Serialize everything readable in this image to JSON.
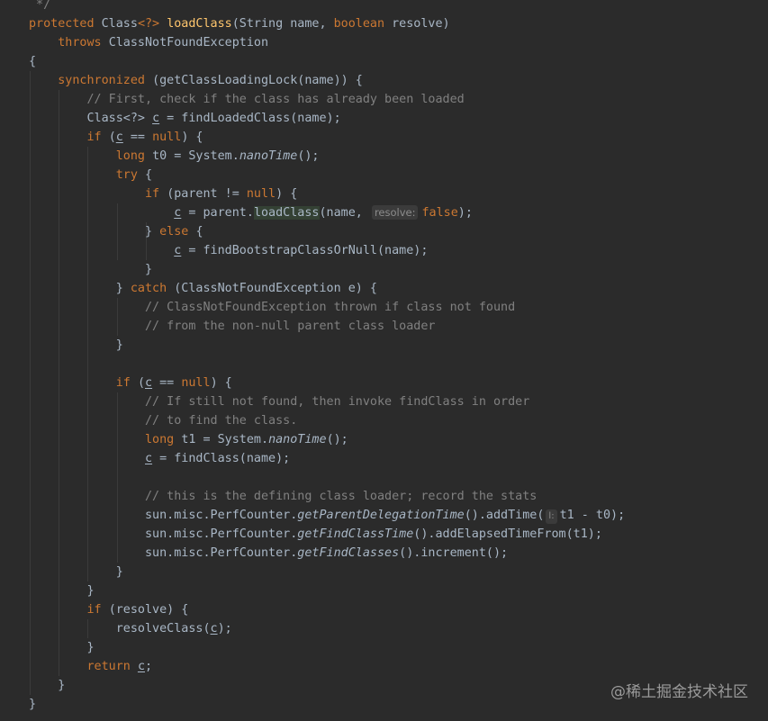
{
  "editor": {
    "lines": [
      [
        [
          "cm",
          " */"
        ]
      ],
      [
        [
          "kw",
          "protected "
        ],
        [
          "id",
          "Class"
        ],
        [
          "kw",
          "<?> "
        ],
        [
          "fn",
          "loadClass"
        ],
        [
          "id",
          "(String name, "
        ],
        [
          "kw",
          "boolean "
        ],
        [
          "id",
          "resolve)"
        ]
      ],
      [
        [
          "id",
          "    "
        ],
        [
          "kw",
          "throws "
        ],
        [
          "id",
          "ClassNotFoundException"
        ]
      ],
      [
        [
          "id",
          "{"
        ]
      ],
      [
        [
          "id",
          "    "
        ],
        [
          "kw",
          "synchronized "
        ],
        [
          "id",
          "(getClassLoadingLock(name)) {"
        ]
      ],
      [
        [
          "id",
          "        "
        ],
        [
          "cm",
          "// First, check if the class has already been loaded"
        ]
      ],
      [
        [
          "id",
          "        Class<?> "
        ],
        [
          "ul",
          "c"
        ],
        [
          "id",
          " = findLoadedClass(name);"
        ]
      ],
      [
        [
          "id",
          "        "
        ],
        [
          "kw",
          "if "
        ],
        [
          "id",
          "("
        ],
        [
          "ul",
          "c"
        ],
        [
          "id",
          " == "
        ],
        [
          "kw",
          "null"
        ],
        [
          "id",
          ") {"
        ]
      ],
      [
        [
          "id",
          "            "
        ],
        [
          "kw",
          "long "
        ],
        [
          "id",
          "t0 = System."
        ],
        [
          "it",
          "nanoTime"
        ],
        [
          "id",
          "();"
        ]
      ],
      [
        [
          "id",
          "            "
        ],
        [
          "kw",
          "try "
        ],
        [
          "id",
          "{"
        ]
      ],
      [
        [
          "id",
          "                "
        ],
        [
          "kw",
          "if "
        ],
        [
          "id",
          "(parent != "
        ],
        [
          "kw",
          "null"
        ],
        [
          "id",
          ") {"
        ]
      ],
      [
        [
          "id",
          "                    "
        ],
        [
          "ul",
          "c"
        ],
        [
          "id",
          " = parent."
        ],
        [
          "hl",
          "loadClass"
        ],
        [
          "id",
          "(name, "
        ],
        [
          "hint",
          "resolve:"
        ],
        [
          "kw",
          "false"
        ],
        [
          "id",
          ");"
        ]
      ],
      [
        [
          "id",
          "                } "
        ],
        [
          "kw",
          "else "
        ],
        [
          "id",
          "{"
        ]
      ],
      [
        [
          "id",
          "                    "
        ],
        [
          "ul",
          "c"
        ],
        [
          "id",
          " = findBootstrapClassOrNull(name);"
        ]
      ],
      [
        [
          "id",
          "                }"
        ]
      ],
      [
        [
          "id",
          "            } "
        ],
        [
          "kw",
          "catch "
        ],
        [
          "id",
          "(ClassNotFoundException e) {"
        ]
      ],
      [
        [
          "id",
          "                "
        ],
        [
          "cm",
          "// ClassNotFoundException thrown if class not found"
        ]
      ],
      [
        [
          "id",
          "                "
        ],
        [
          "cm",
          "// from the non-null parent class loader"
        ]
      ],
      [
        [
          "id",
          "            }"
        ]
      ],
      [
        [
          "id",
          ""
        ]
      ],
      [
        [
          "id",
          "            "
        ],
        [
          "kw",
          "if "
        ],
        [
          "id",
          "("
        ],
        [
          "ul",
          "c"
        ],
        [
          "id",
          " == "
        ],
        [
          "kw",
          "null"
        ],
        [
          "id",
          ") {"
        ]
      ],
      [
        [
          "id",
          "                "
        ],
        [
          "cm",
          "// If still not found, then invoke findClass in order"
        ]
      ],
      [
        [
          "id",
          "                "
        ],
        [
          "cm",
          "// to find the class."
        ]
      ],
      [
        [
          "id",
          "                "
        ],
        [
          "kw",
          "long "
        ],
        [
          "id",
          "t1 = System."
        ],
        [
          "it",
          "nanoTime"
        ],
        [
          "id",
          "();"
        ]
      ],
      [
        [
          "id",
          "                "
        ],
        [
          "ul",
          "c"
        ],
        [
          "id",
          " = findClass(name);"
        ]
      ],
      [
        [
          "id",
          ""
        ]
      ],
      [
        [
          "id",
          "                "
        ],
        [
          "cm",
          "// this is the defining class loader; record the stats"
        ]
      ],
      [
        [
          "id",
          "                sun.misc.PerfCounter."
        ],
        [
          "it",
          "getParentDelegationTime"
        ],
        [
          "id",
          "().addTime("
        ],
        [
          "icon",
          "l:"
        ],
        [
          "id",
          "t1 - t0);"
        ]
      ],
      [
        [
          "id",
          "                sun.misc.PerfCounter."
        ],
        [
          "it",
          "getFindClassTime"
        ],
        [
          "id",
          "().addElapsedTimeFrom(t1);"
        ]
      ],
      [
        [
          "id",
          "                sun.misc.PerfCounter."
        ],
        [
          "it",
          "getFindClasses"
        ],
        [
          "id",
          "().increment();"
        ]
      ],
      [
        [
          "id",
          "            }"
        ]
      ],
      [
        [
          "id",
          "        }"
        ]
      ],
      [
        [
          "id",
          "        "
        ],
        [
          "kw",
          "if "
        ],
        [
          "id",
          "(resolve) {"
        ]
      ],
      [
        [
          "id",
          "            resolveClass("
        ],
        [
          "ul",
          "c"
        ],
        [
          "id",
          ");"
        ]
      ],
      [
        [
          "id",
          "        }"
        ]
      ],
      [
        [
          "id",
          "        "
        ],
        [
          "kw",
          "return "
        ],
        [
          "ul",
          "c"
        ],
        [
          "id",
          ";"
        ]
      ],
      [
        [
          "id",
          "    }"
        ]
      ],
      [
        [
          "id",
          "}"
        ]
      ]
    ]
  },
  "watermark": "@稀土掘金技术社区"
}
